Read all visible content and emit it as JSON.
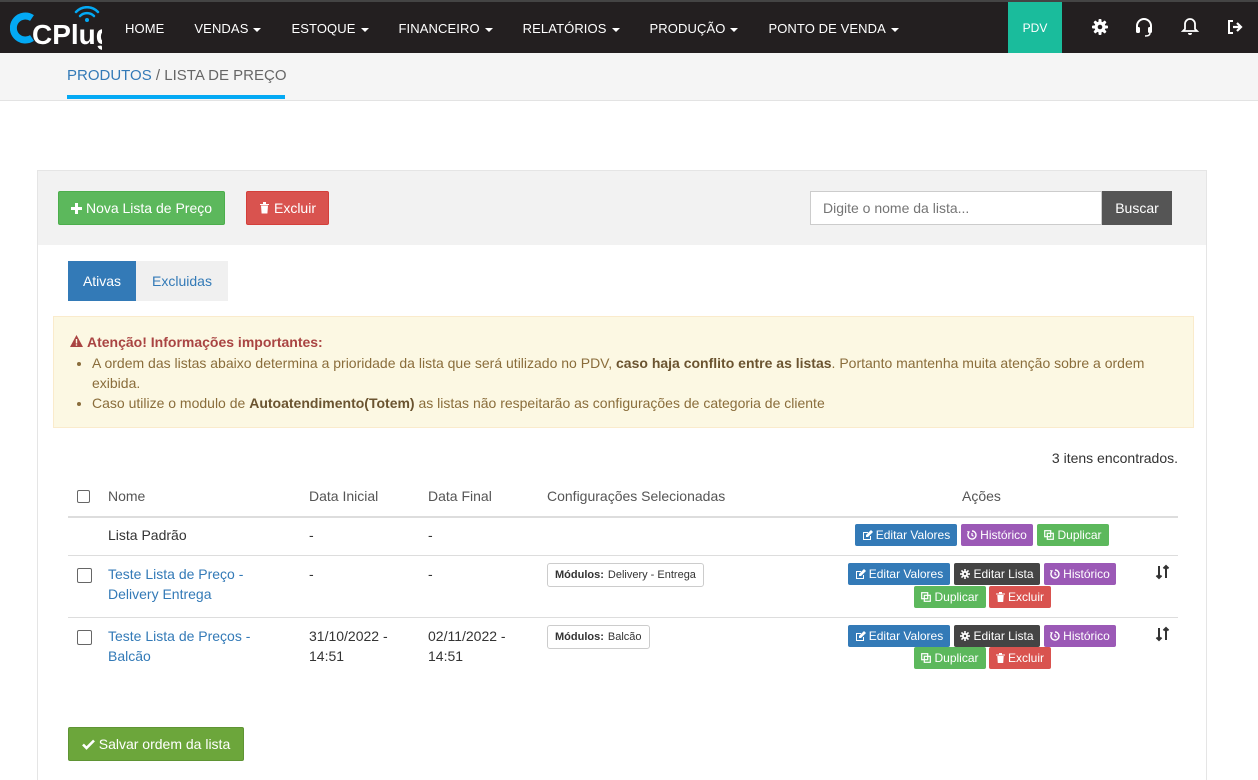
{
  "nav": {
    "logo_text": "CPlug",
    "items": [
      {
        "label": "HOME",
        "caret": false
      },
      {
        "label": "VENDAS",
        "caret": true
      },
      {
        "label": "ESTOQUE",
        "caret": true
      },
      {
        "label": "FINANCEIRO",
        "caret": true
      },
      {
        "label": "RELATÓRIOS",
        "caret": true
      },
      {
        "label": "PRODUÇÃO",
        "caret": true
      },
      {
        "label": "PONTO DE VENDA",
        "caret": true
      }
    ],
    "pdv_label": "PDV",
    "icons": [
      "gear-icon",
      "headset-icon",
      "bell-icon",
      "logout-icon"
    ]
  },
  "breadcrumb": {
    "parent": "PRODUTOS",
    "separator": " / ",
    "current": "LISTA DE PREÇO"
  },
  "toolbar": {
    "new_label": "Nova Lista de Preço",
    "delete_label": "Excluir",
    "search_placeholder": "Digite o nome da lista...",
    "search_button": "Buscar"
  },
  "tabs": {
    "active": "Ativas",
    "inactive": "Excluidas"
  },
  "alert": {
    "title": "Atenção! Informações importantes:",
    "item1_pre": "A ordem das listas abaixo determina a prioridade da lista que será utilizado no PDV, ",
    "item1_bold": "caso haja conflito entre as listas",
    "item1_post": ". Portanto mantenha muita atenção sobre a ordem exibida.",
    "item2_pre": "Caso utilize o modulo de ",
    "item2_bold": "Autoatendimento(Totem)",
    "item2_post": " as listas não respeitarão as configurações de categoria de cliente"
  },
  "count_text": "3 itens encontrados.",
  "table": {
    "headers": {
      "name": "Nome",
      "start": "Data Inicial",
      "end": "Data Final",
      "config": "Configurações Selecionadas",
      "actions": "Ações"
    },
    "rows": [
      {
        "name_l1": "Lista Padrão",
        "name_l2": "",
        "start_l1": "-",
        "start_l2": "",
        "end_l1": "-",
        "end_l2": "",
        "module_label": "",
        "module_value": ""
      },
      {
        "name_l1": "Teste Lista de Preço -",
        "name_l2": "Delivery Entrega",
        "start_l1": "-",
        "start_l2": "",
        "end_l1": "-",
        "end_l2": "",
        "module_label": "Módulos:",
        "module_value": "Delivery - Entrega"
      },
      {
        "name_l1": "Teste Lista de Preços -",
        "name_l2": "Balcão",
        "start_l1": "31/10/2022 -",
        "start_l2": "14:51",
        "end_l1": "02/11/2022 -",
        "end_l2": "14:51",
        "module_label": "Módulos:",
        "module_value": "Balcão"
      }
    ],
    "action_labels": {
      "edit_values": "Editar Valores",
      "history": "Histórico",
      "duplicate": "Duplicar",
      "edit_list": "Editar Lista",
      "delete": "Excluir"
    }
  },
  "save_order_label": "Salvar ordem da lista",
  "colors": {
    "navbar": "#231f20",
    "pdv": "#1abc9c",
    "primary": "#337ab7",
    "success": "#5cb85c",
    "danger": "#d9534f",
    "purple": "#9b59b6",
    "accent_underline": "#03a9f4"
  }
}
